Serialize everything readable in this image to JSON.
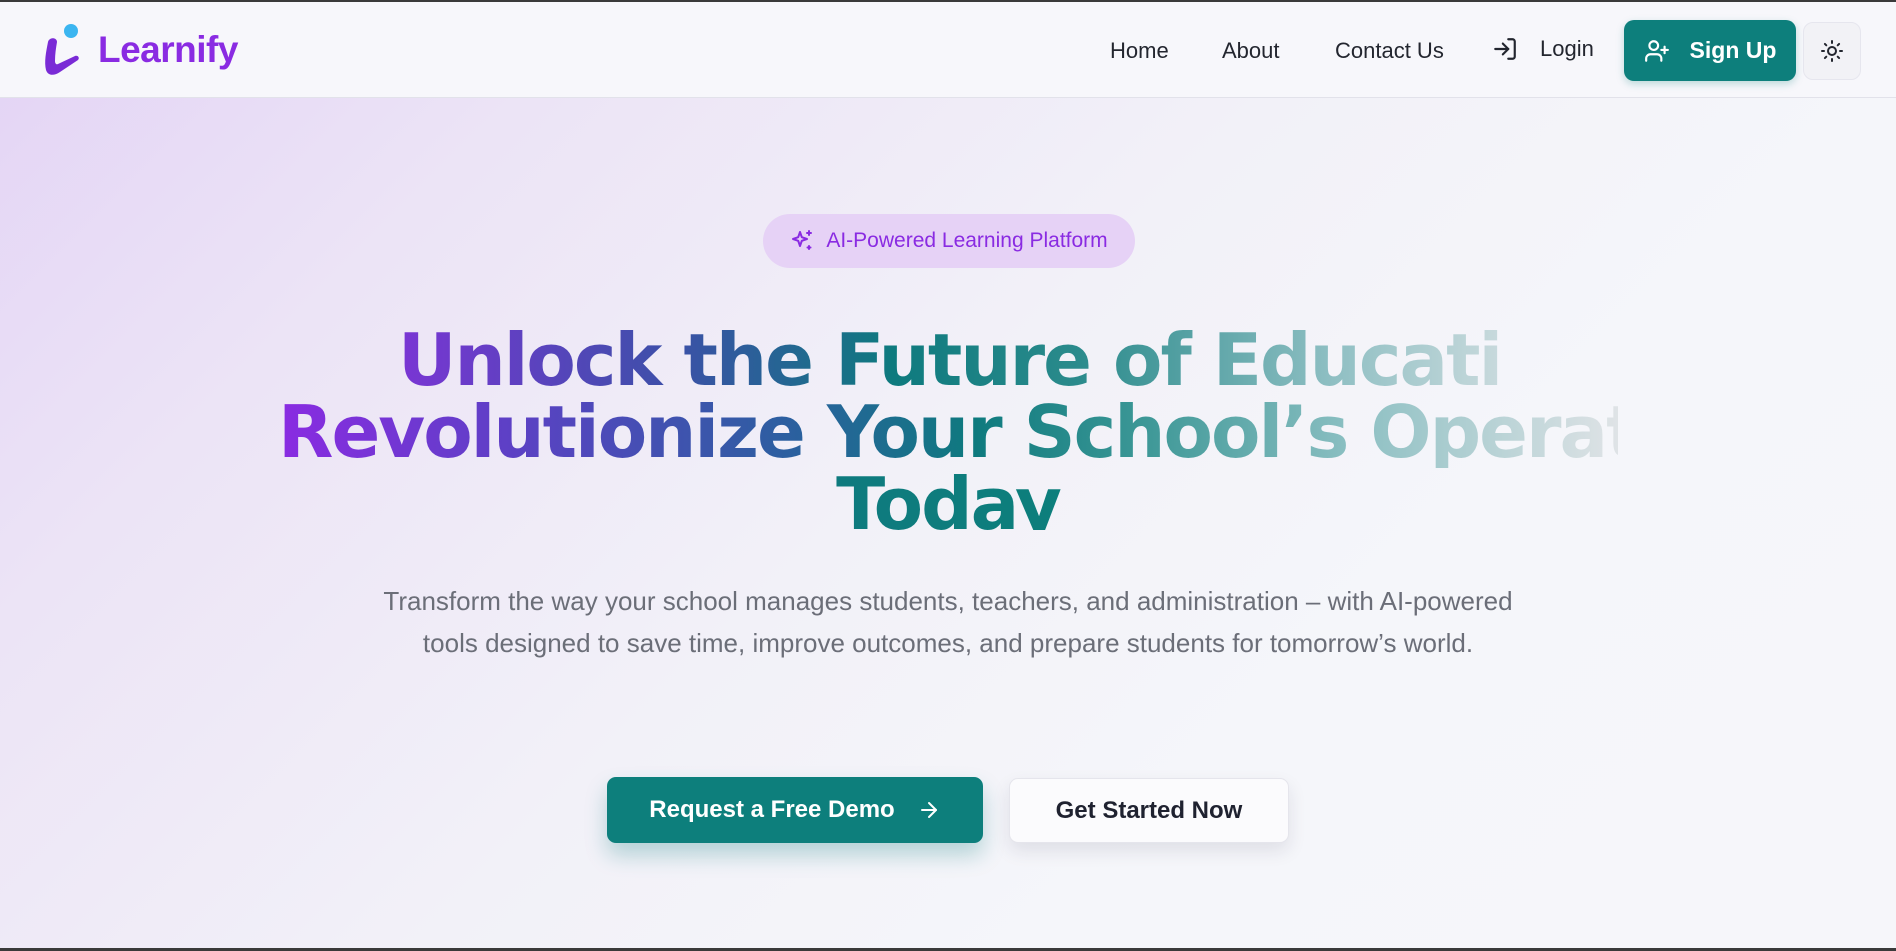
{
  "brand": {
    "name": "Learnify",
    "logo_icon": "learnify-logo-icon",
    "color": "#8a2be2"
  },
  "nav": {
    "links": [
      "Home",
      "About",
      "Contact Us"
    ],
    "login_label": "Login",
    "login_icon": "login-icon",
    "signup_label": "Sign Up",
    "signup_icon": "user-plus-icon",
    "theme_icon": "sun-icon"
  },
  "hero": {
    "badge": {
      "icon": "sparkles-icon",
      "label": "AI-Powered Learning Platform"
    },
    "headline": {
      "line1": "Unlock the Future of Education –",
      "line2": "Revolutionize Your School’s Operations",
      "line3": "Today"
    },
    "subtitle": "Transform the way your school manages students, teachers, and administration – with AI-powered tools designed to save time, improve outcomes, and prepare students for tomorrow’s world.",
    "primary_cta": {
      "label": "Request a Free Demo",
      "icon": "arrow-right-icon"
    },
    "secondary_cta": {
      "label": "Get Started Now"
    }
  },
  "colors": {
    "primary_teal": "#0d7f7c",
    "brand_purple": "#8a2be2",
    "badge_bg": "#e6d2f6",
    "subtitle_gray": "#6b6e78"
  }
}
